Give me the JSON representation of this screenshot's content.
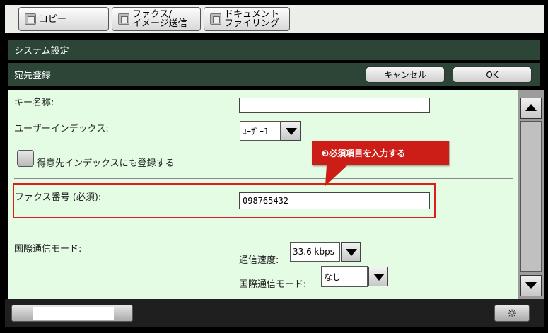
{
  "tabs": [
    {
      "label": "コピー",
      "icon": "copy-icon"
    },
    {
      "label": "ファクス/\nイメージ送信",
      "icon": "fax-icon"
    },
    {
      "label": "ドキュメント\nファイリング",
      "icon": "document-filing-icon"
    }
  ],
  "header": {
    "title": "システム設定",
    "subtitle": "宛先登録",
    "cancel_label": "キャンセル",
    "ok_label": "OK"
  },
  "form": {
    "key_name_label": "キー名称:",
    "key_name_value": "",
    "user_index_label": "ユーザーインデックス:",
    "user_index_value": "ﾕｰｻﾞｰ1",
    "favorite_label": "得意先インデックスにも登録する",
    "fax_number_label": "ファクス番号 (必須):",
    "fax_number_value": "098765432",
    "intl_mode_label": "国際通信モード:",
    "speed_label": "通信速度:",
    "speed_value": "33.6 kbps",
    "intl_comm_label": "国際通信モード:",
    "intl_comm_value": "なし"
  },
  "callout": {
    "text": "❸必須項目を入力する",
    "color": "#cc1d16"
  },
  "colors": {
    "header_bar": "#2c4537",
    "content_bg": "#e4fbe4",
    "highlight": "#e01b1b"
  },
  "icons": {
    "scroll_up": "triangle-up-icon",
    "scroll_down": "triangle-down-icon",
    "brightness": "brightness-icon"
  },
  "bottom": {
    "brightness_glyph": "☼"
  }
}
